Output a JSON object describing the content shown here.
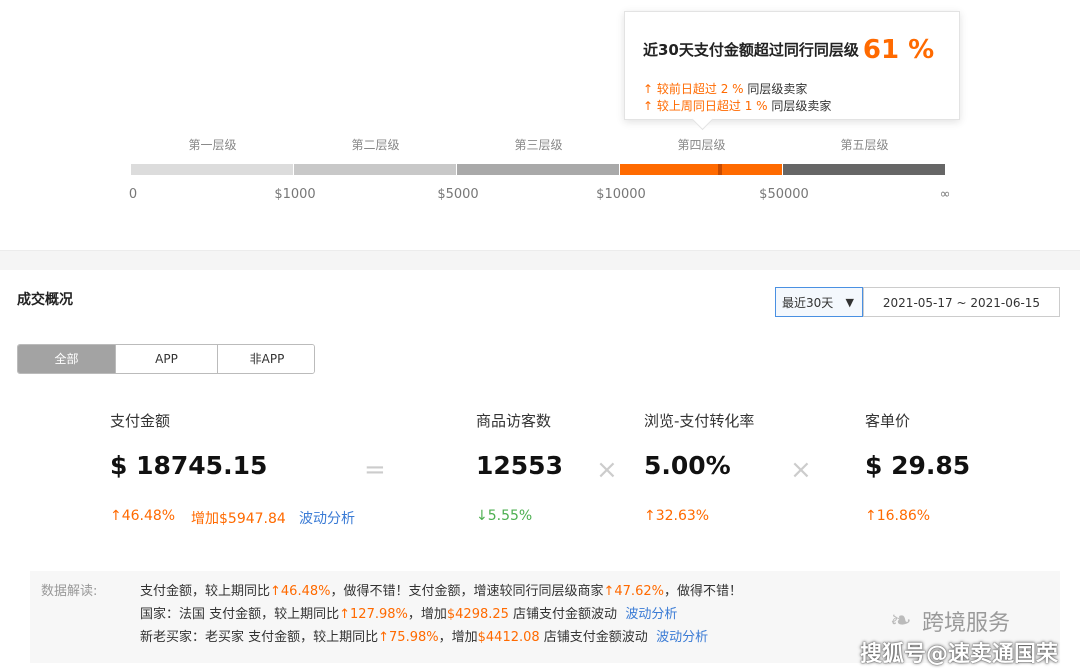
{
  "tooltip": {
    "title": "近30天支付金额超过同行同层级",
    "percent": "61 %",
    "line1_prefix": "↑ 较前日超过",
    "line1_value": "2 %",
    "line1_suffix": "同层级卖家",
    "line2_prefix": "↑ 较上周同日超过",
    "line2_value": "1 %",
    "line2_suffix": "同层级卖家"
  },
  "tiers": {
    "labels": [
      "第一层级",
      "第二层级",
      "第三层级",
      "第四层级",
      "第五层级"
    ],
    "ticks": [
      "0",
      "$1000",
      "$5000",
      "$10000",
      "$50000",
      "∞"
    ],
    "current_tier": 4,
    "colors": [
      "#dcdcdc",
      "#c8c8c8",
      "#a9a9a9",
      "#ff6a00",
      "#666666"
    ]
  },
  "section": {
    "title": "成交概况",
    "range_select": "最近30天",
    "date_range": "2021-05-17 ~ 2021-06-15"
  },
  "tabs": [
    "全部",
    "APP",
    "非APP"
  ],
  "metrics": {
    "payment": {
      "label": "支付金额",
      "value": "$ 18745.15",
      "change": "↑46.48%",
      "increase": "增加$5947.84",
      "link": "波动分析"
    },
    "op_eq": "=",
    "visitors": {
      "label": "商品访客数",
      "value": "12553",
      "change": "↓5.55%"
    },
    "op_x1": "×",
    "conversion": {
      "label": "浏览-支付转化率",
      "value": "5.00%",
      "change": "↑32.63%"
    },
    "op_x2": "×",
    "avg_price": {
      "label": "客单价",
      "value": "$ 29.85",
      "change": "↑16.86%"
    }
  },
  "interpretation": {
    "label": "数据解读:",
    "line1": {
      "a": "支付金额，较上期同比",
      "b": "↑46.48%",
      "c": "，做得不错！支付金额，增速较同行同层级商家",
      "d": "↑47.62%",
      "e": "，做得不错！"
    },
    "line2": {
      "a": "国家：法国   支付金额，较上期同比",
      "b": "↑127.98%",
      "c": "，增加",
      "d": "$4298.25",
      "e": " 店铺支付金额波动",
      "link": "波动分析"
    },
    "line3": {
      "a": "新老买家：老买家   支付金额，较上期同比",
      "b": "↑75.98%",
      "c": "，增加",
      "d": "$4412.08",
      "e": " 店铺支付金额波动",
      "link": "波动分析"
    }
  },
  "watermark": {
    "icon": "wechat-icon",
    "text1": "跨境服务",
    "text2": "搜狐号@速卖通国荣"
  }
}
